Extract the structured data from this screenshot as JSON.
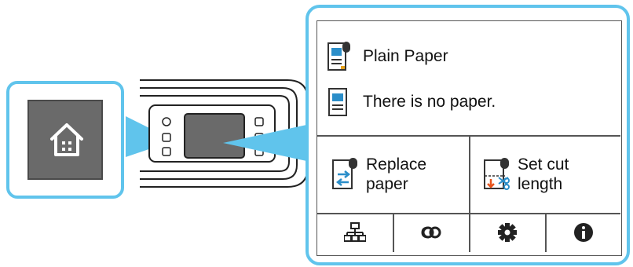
{
  "status": {
    "media_type": "Plain Paper",
    "paper_message": "There is no paper."
  },
  "actions": {
    "replace": {
      "line1": "Replace",
      "line2": "paper"
    },
    "cut": {
      "line1": "Set cut",
      "line2": "length"
    }
  },
  "footer_icons": [
    "network-icon",
    "link-icon",
    "settings-gear-icon",
    "info-icon"
  ],
  "colors": {
    "callout_border": "#60c4ec",
    "home_button": "#6a6a6a",
    "accent_orange": "#e8541c",
    "accent_blue": "#2b8ec9"
  }
}
